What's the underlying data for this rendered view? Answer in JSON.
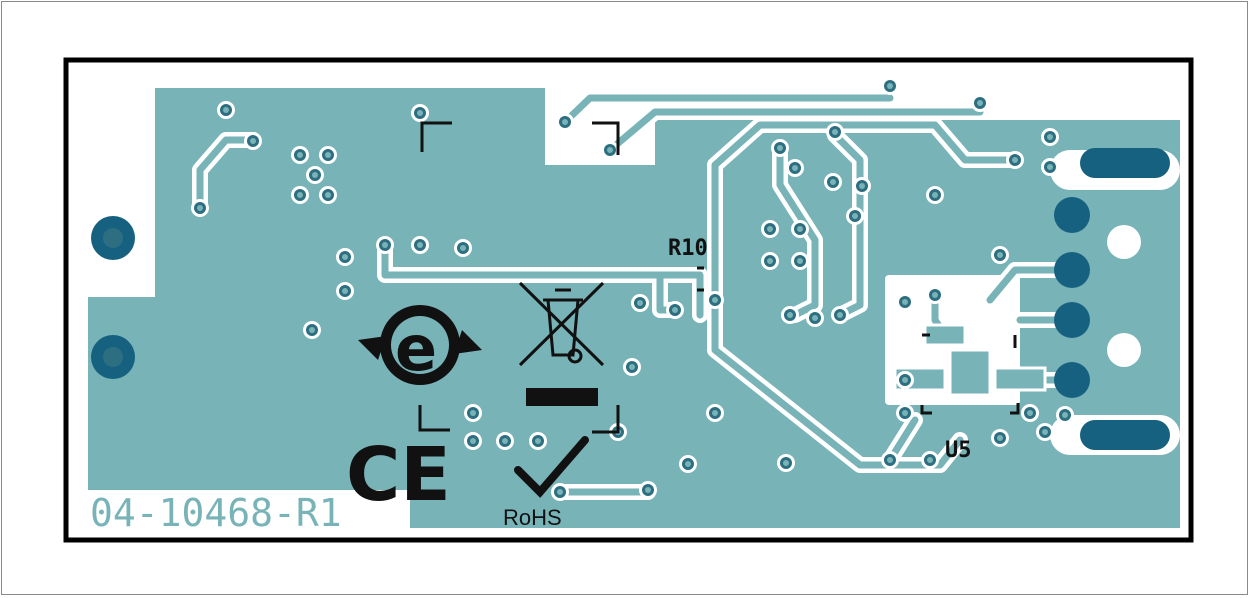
{
  "board": {
    "part_number": "04-10468-R1",
    "ref_r10": "R10",
    "ref_u5": "U5",
    "rohs_text": "RoHS",
    "ce_text": "CE",
    "efup_text": "e"
  },
  "colors": {
    "copper": "#77b3b7",
    "trace": "#77b3b7",
    "via": "#2d6f80",
    "pad": "#16617f",
    "silk": "#111111",
    "outline": "#000000"
  }
}
